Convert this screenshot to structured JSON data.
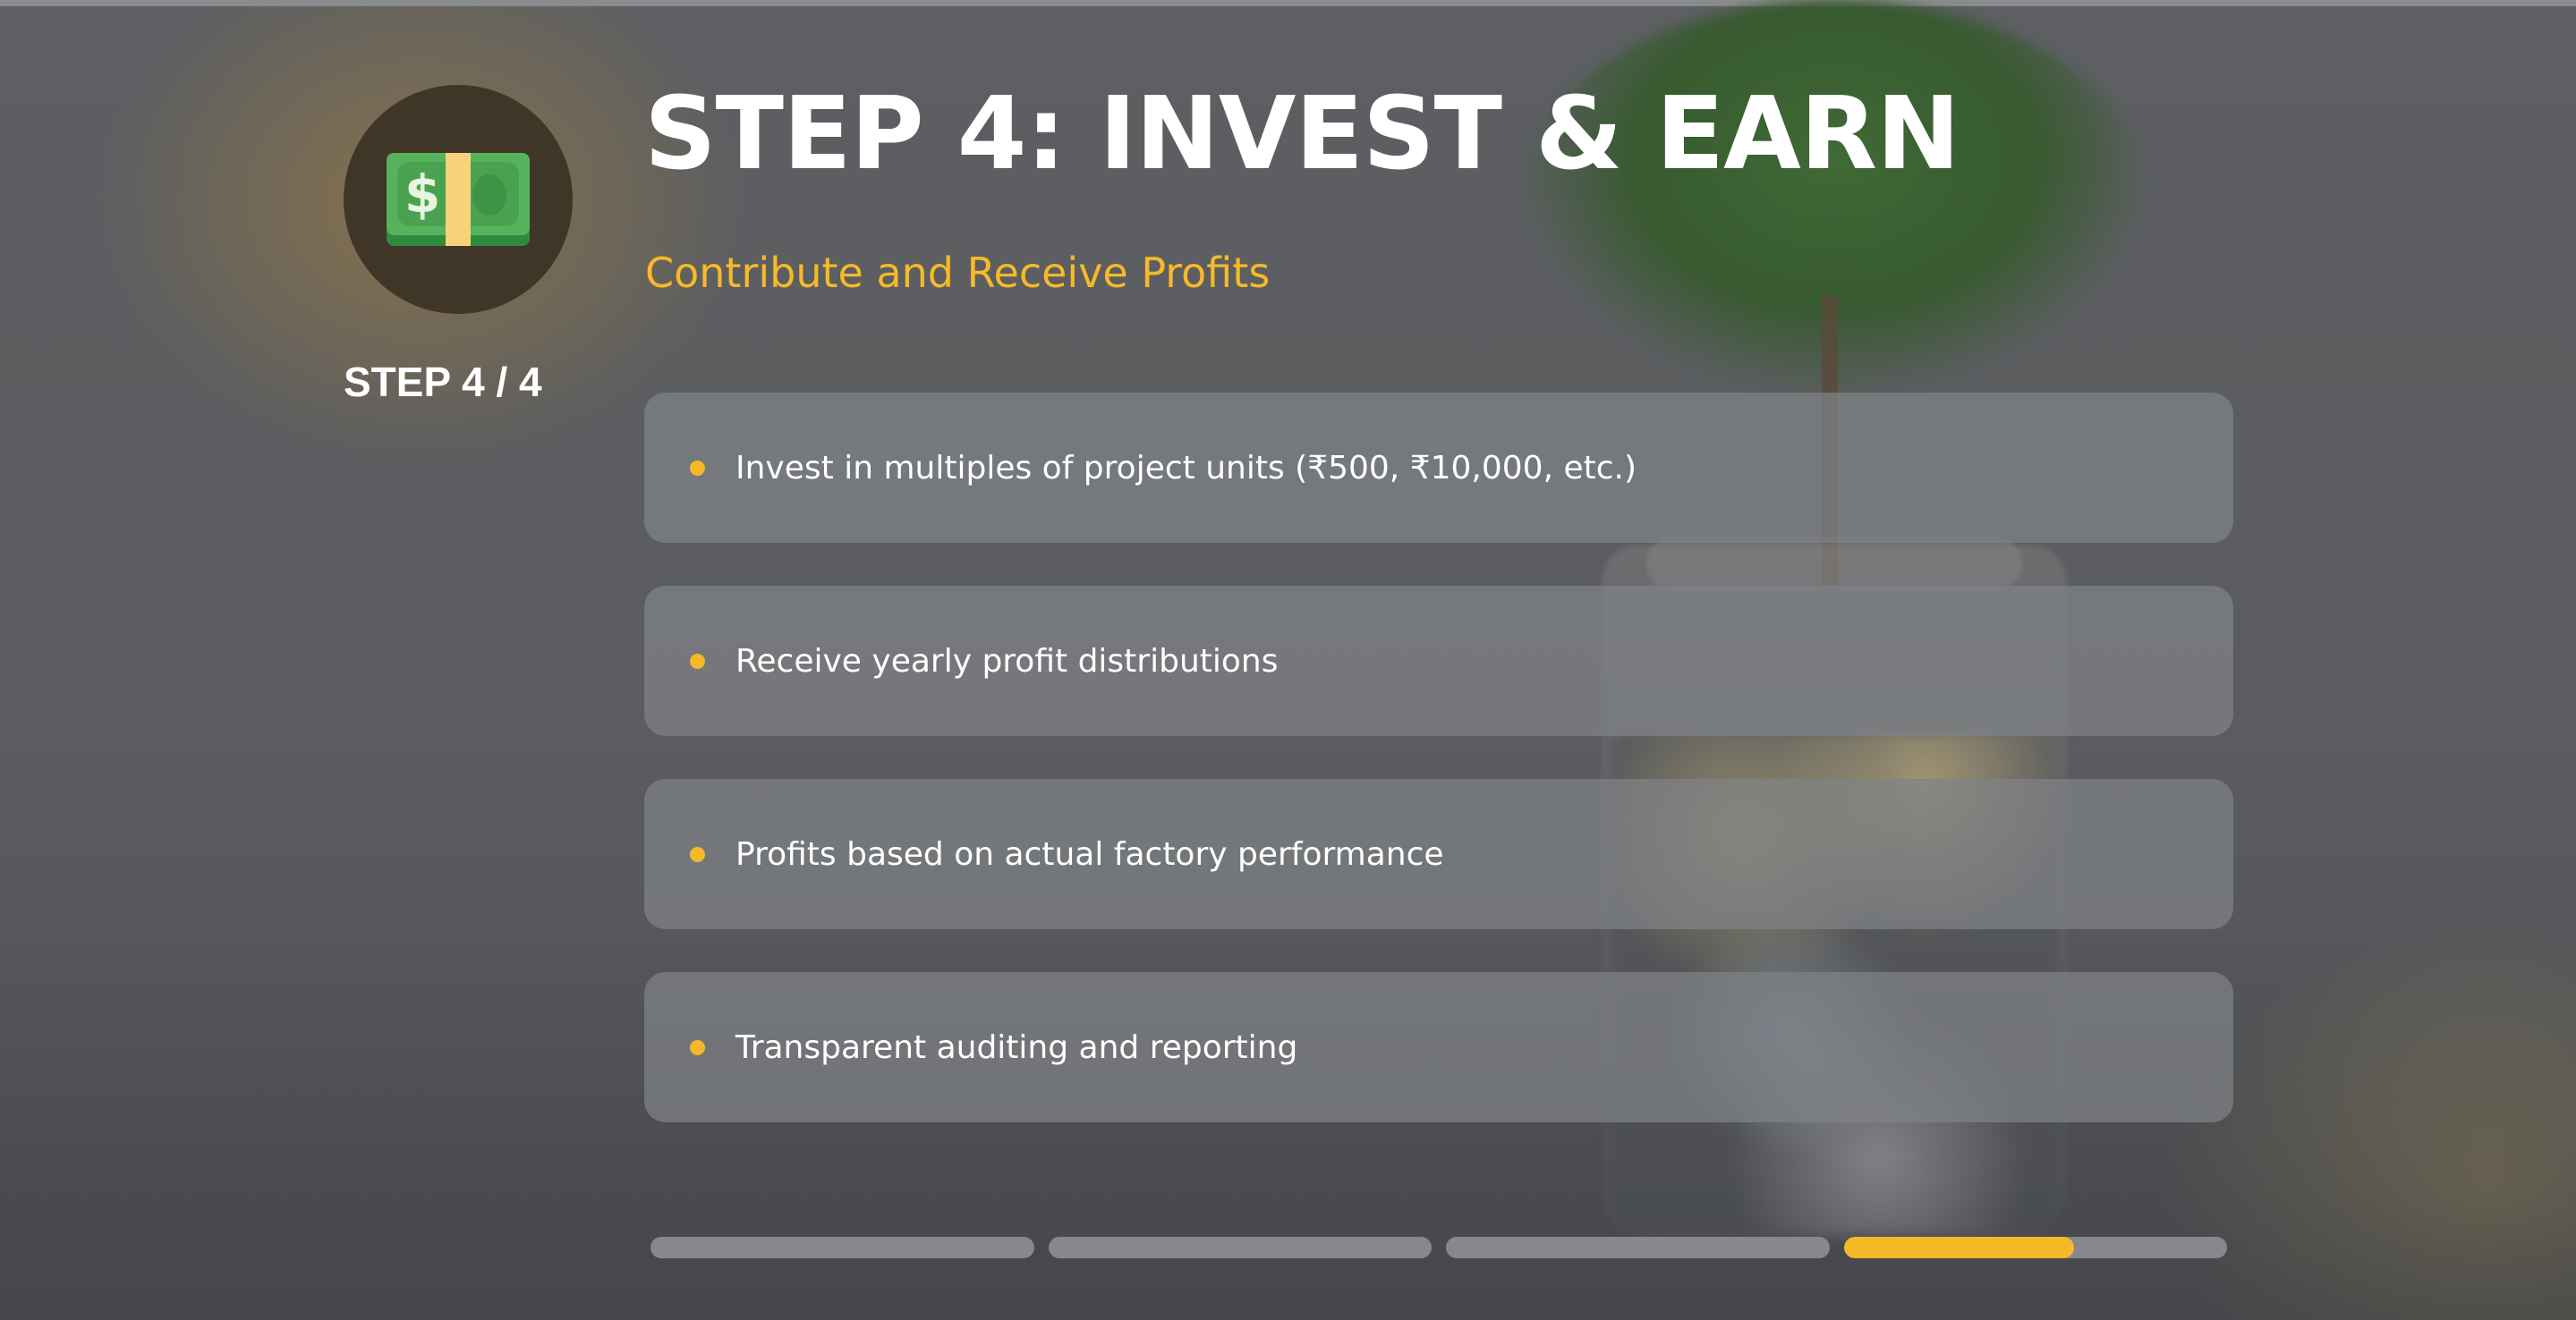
{
  "step": {
    "title": "STEP 4: INVEST & EARN",
    "subtitle": "Contribute and Receive Profits",
    "counter": "STEP 4 / 4",
    "icon": "money-bill-icon",
    "icon_glyph": "$"
  },
  "points": [
    "Invest in multiples of project units (₹500, ₹10,000, etc.)",
    "Receive yearly profit distributions",
    "Profits based on actual factory performance",
    "Transparent auditing and reporting"
  ],
  "progress": {
    "total_steps": 4,
    "current_step": 4,
    "current_step_fill": 0.6
  },
  "colors": {
    "accent": "#f5b829",
    "text": "#ffffff",
    "card": "#808286"
  }
}
